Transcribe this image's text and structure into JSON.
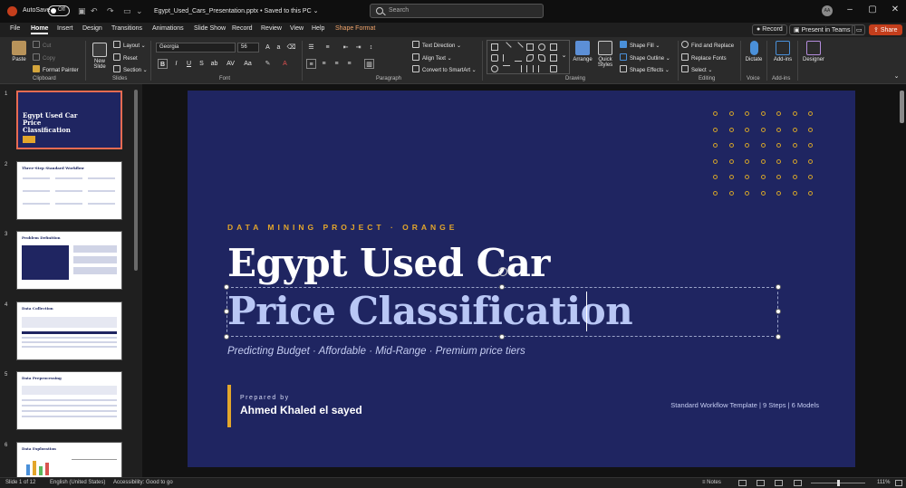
{
  "titlebar": {
    "autosave_label": "AutoSave",
    "autosave_state": "Off",
    "filename": "Egypt_Used_Cars_Presentation.pptx • Saved to this PC ⌄",
    "search_placeholder": "Search",
    "avatar_initials": "AA"
  },
  "menu": {
    "tabs": [
      "File",
      "Home",
      "Insert",
      "Design",
      "Transitions",
      "Animations",
      "Slide Show",
      "Record",
      "Review",
      "View",
      "Help",
      "Shape Format"
    ],
    "record_btn": "Record",
    "teams_btn": "Present in Teams",
    "share_btn": "Share"
  },
  "ribbon": {
    "clipboard": {
      "label": "Clipboard",
      "paste": "Paste",
      "cut": "Cut",
      "copy": "Copy",
      "format_painter": "Format Painter"
    },
    "slides": {
      "label": "Slides",
      "new_slide": "New Slide",
      "layout": "Layout",
      "reset": "Reset",
      "section": "Section"
    },
    "font": {
      "label": "Font",
      "font_name": "Georgia",
      "font_size": "56"
    },
    "paragraph": {
      "label": "Paragraph",
      "text_direction": "Text Direction",
      "align_text": "Align Text",
      "smartart": "Convert to SmartArt"
    },
    "drawing": {
      "label": "Drawing",
      "arrange": "Arrange",
      "quick_styles": "Quick Styles",
      "shape_fill": "Shape Fill",
      "shape_outline": "Shape Outline",
      "shape_effects": "Shape Effects"
    },
    "editing": {
      "label": "Editing",
      "find_replace": "Find and Replace",
      "replace_fonts": "Replace Fonts",
      "select": "Select"
    },
    "voice": {
      "label": "Voice",
      "dictate": "Dictate"
    },
    "addins": {
      "label": "Add-ins",
      "addins_btn": "Add-ins"
    },
    "designer": {
      "designer_btn": "Designer"
    }
  },
  "thumbnails": [
    {
      "num": "1",
      "title": "Egypt Used Car Price Classification"
    },
    {
      "num": "2",
      "title": "Three-Step Standard Workflow"
    },
    {
      "num": "3",
      "title": "Problem Definition"
    },
    {
      "num": "4",
      "title": "Data Collection"
    },
    {
      "num": "5",
      "title": "Data Preprocessing"
    },
    {
      "num": "6",
      "title": "Data Exploration"
    }
  ],
  "slide": {
    "kicker": "DATA MINING PROJECT · ORANGE",
    "title_line1": "Egypt Used Car",
    "title_line2": "Price Classification",
    "subtitle": "Predicting Budget · Affordable · Mid-Range · Premium price tiers",
    "prepared_by": "Prepared by",
    "author": "Ahmed Khaled el sayed",
    "footer_note": "Standard Workflow Template | 9 Steps | 6 Models",
    "colors": {
      "background": "#1f2561",
      "accent": "#e3a62b",
      "title_primary": "#ffffff",
      "title_secondary": "#b9c7f5"
    }
  },
  "statusbar": {
    "slide_counter": "Slide 1 of 12",
    "language": "English (United States)",
    "accessibility": "Accessibility: Good to go",
    "notes": "Notes",
    "zoom": "111%"
  }
}
